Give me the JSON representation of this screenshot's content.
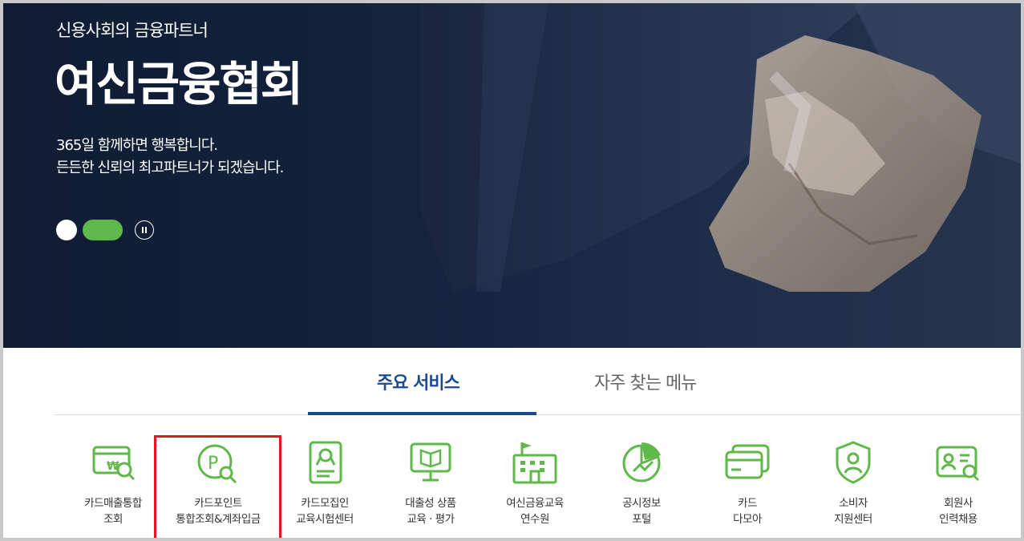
{
  "hero": {
    "subtitle": "신용사회의 금융파트너",
    "title": "여신금융협회",
    "desc_line1": "365일 함께하면 행복합니다.",
    "desc_line2": "든든한 신뢰의 최고파트너가 되겠습니다."
  },
  "tabs": [
    {
      "label": "주요 서비스",
      "active": true
    },
    {
      "label": "자주 찾는 메뉴",
      "active": false
    }
  ],
  "services": [
    {
      "line1": "카드매출통합",
      "line2": "조회",
      "icon": "card-sales-search-icon"
    },
    {
      "line1": "카드포인트",
      "line2": "통합조회&계좌입금",
      "icon": "point-search-icon"
    },
    {
      "line1": "카드모집인",
      "line2": "교육시험센터",
      "icon": "certificate-icon"
    },
    {
      "line1": "대출성 상품",
      "line2": "교육 · 평가",
      "icon": "monitor-book-icon"
    },
    {
      "line1": "여신금융교육",
      "line2": "연수원",
      "icon": "school-building-icon"
    },
    {
      "line1": "공시정보",
      "line2": "포털",
      "icon": "pie-chart-icon"
    },
    {
      "line1": "카드",
      "line2": "다모아",
      "icon": "cards-icon"
    },
    {
      "line1": "소비자",
      "line2": "지원센터",
      "icon": "shield-user-icon"
    },
    {
      "line1": "회원사",
      "line2": "인력채용",
      "icon": "id-card-search-icon"
    }
  ],
  "colors": {
    "accent": "#1a4a91",
    "green": "#5fb84a",
    "highlight": "#e4161b"
  }
}
